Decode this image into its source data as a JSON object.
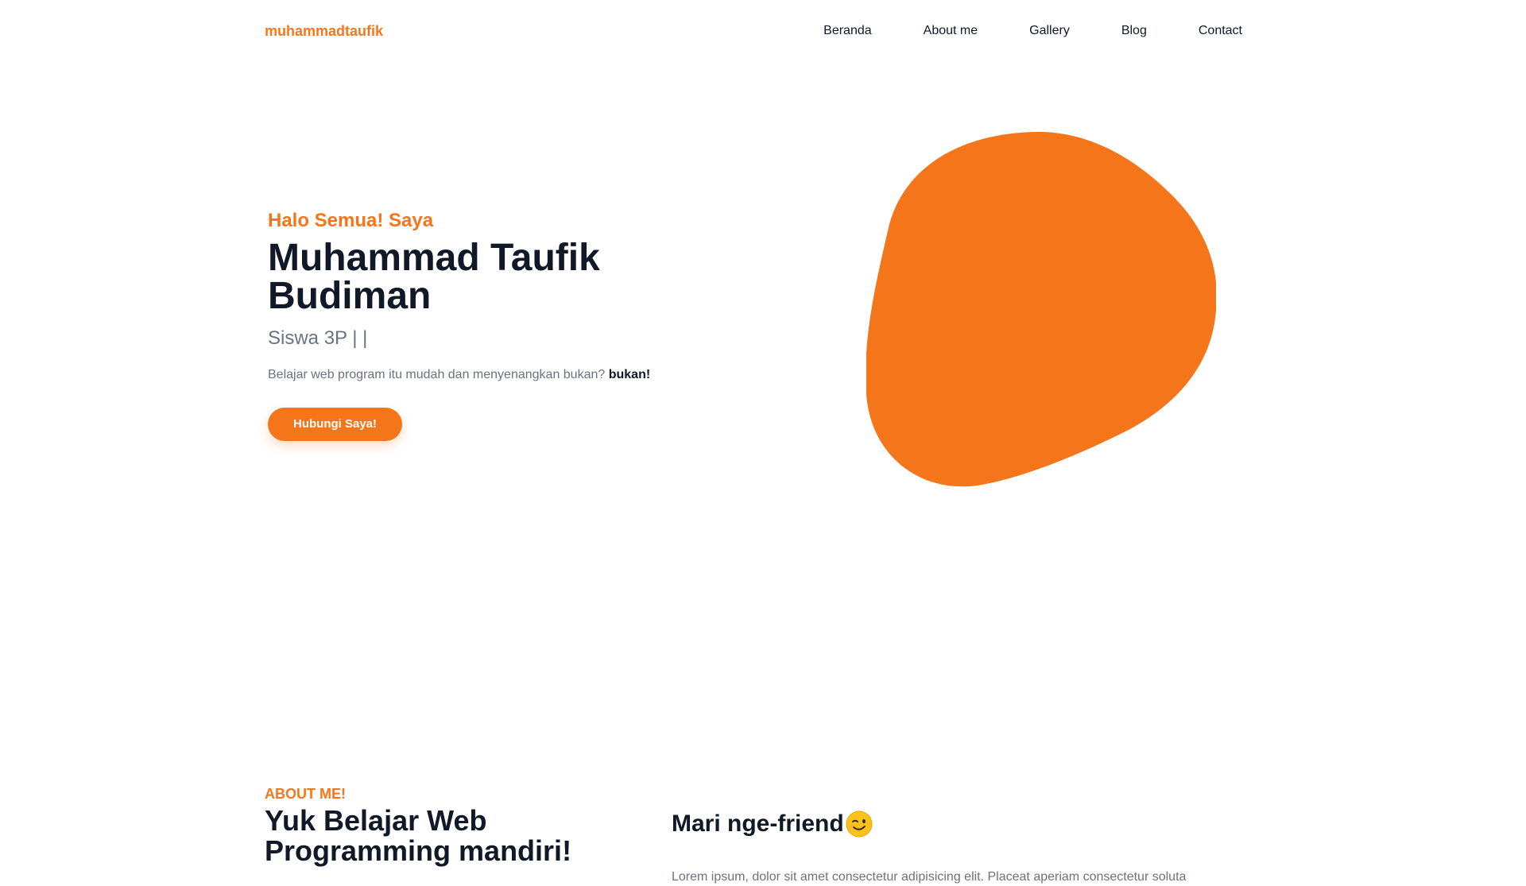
{
  "nav": {
    "brand": "muhammadtaufik",
    "links": [
      "Beranda",
      "About me",
      "Gallery",
      "Blog",
      "Contact"
    ]
  },
  "hero": {
    "greeting": "Halo Semua! Saya",
    "name": "Muhammad Taufik Budiman",
    "role": "Siswa 3P | |",
    "description": "Belajar web program itu mudah dan menyenangkan bukan?",
    "description_emphasis": "bukan!",
    "button_label": "Hubungi Saya!"
  },
  "about": {
    "label": "ABOUT ME!",
    "title": "Yuk Belajar Web Programming mandiri!",
    "subtitle": "Mari nge-friend",
    "text": "Lorem ipsum, dolor sit amet consectetur adipisicing elit. Placeat aperiam consectetur soluta"
  },
  "colors": {
    "accent": "#f5761a",
    "heading": "#111827",
    "muted": "#6b7280",
    "background": "#ffffff"
  },
  "icons": {
    "blob": "orange-blob-illustration",
    "emoji": "winking-face-icon"
  }
}
